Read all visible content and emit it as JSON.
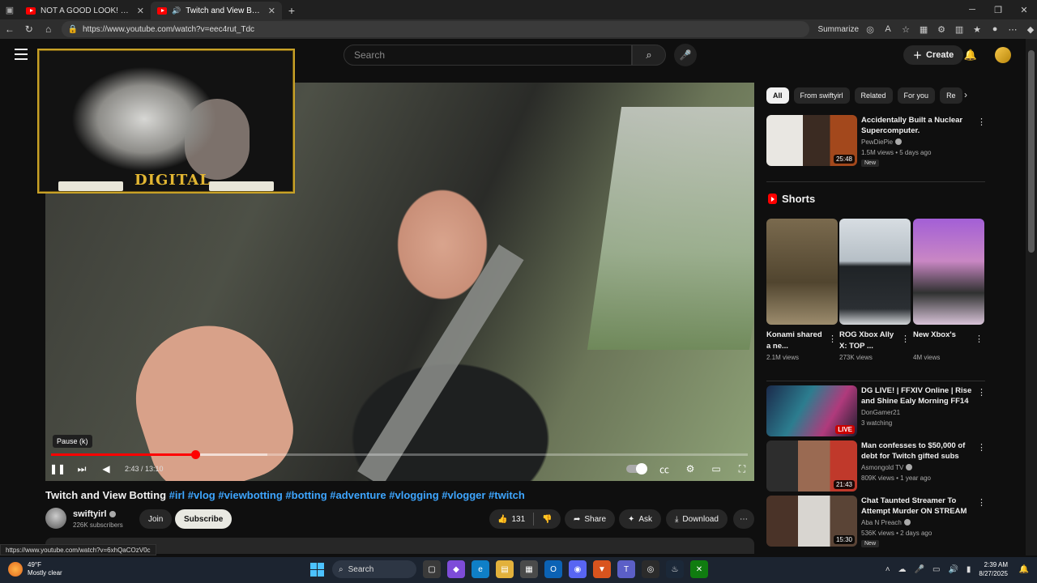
{
  "browser": {
    "tabs": [
      {
        "title": "NOT A GOOD LOOK! Dan Amrich"
      },
      {
        "title": "Twitch and View Botting #irl"
      }
    ],
    "url": "https://www.youtube.com/watch?v=eec4rut_Tdc",
    "summarize_label": "Summarize",
    "status_url": "https://www.youtube.com/watch?v=6xhQaCOzV0c"
  },
  "header": {
    "search_placeholder": "Search",
    "create_label": "Create"
  },
  "player": {
    "overlay_logo": "DIGITAL",
    "tooltip": "Pause (k)",
    "time": "2:43 / 13:10",
    "progress": 0.207,
    "buffered": 0.31
  },
  "video": {
    "title": "Twitch and View Botting",
    "tags": "#irl #vlog #viewbotting #botting #adventure #vlogging #vlogger #twitch",
    "channel": "swiftyirl",
    "subscribers": "226K subscribers",
    "join_label": "Join",
    "subscribe_label": "Subscribe",
    "likes": "131",
    "share_label": "Share",
    "ask_label": "Ask",
    "download_label": "Download"
  },
  "sidebar": {
    "chips": [
      "All",
      "From swiftyirl",
      "Related",
      "For you",
      "Re"
    ],
    "top_video": {
      "title": "Accidentally Built a Nuclear Supercomputer.",
      "channel": "PewDiePie",
      "meta": "1.5M views • 5 days ago",
      "badge": "New",
      "duration": "25:48"
    },
    "shorts_title": "Shorts",
    "shorts": [
      {
        "title": "Konami shared a ne...",
        "views": "2.1M views"
      },
      {
        "title": "ROG Xbox Ally X: TOP ...",
        "views": "273K views"
      },
      {
        "title": "New Xbox's",
        "views": "4M views"
      }
    ],
    "videos": [
      {
        "title": "DG LIVE! | FFXIV Online | Rise and Shine Ealy Morning FF14 ...",
        "channel": "DonGamer21",
        "meta": "3 watching",
        "live": "LIVE"
      },
      {
        "title": "Man confesses to $50,000 of debt for Twitch gifted subs",
        "channel": "Asmongold TV",
        "meta": "809K views • 1 year ago",
        "duration": "21:43"
      },
      {
        "title": "Chat Taunted Streamer To Attempt Murder ON STREAM",
        "channel": "Aba N Preach",
        "meta": "536K views • 2 days ago",
        "badge": "New",
        "duration": "15:30"
      }
    ]
  },
  "taskbar": {
    "temp": "49°F",
    "weather": "Mostly clear",
    "search_label": "Search",
    "time": "2:39 AM",
    "date": "8/27/2025"
  },
  "colors": {
    "accent": "#ff0000",
    "link": "#3ea6ff",
    "background": "#0f0f0f"
  }
}
